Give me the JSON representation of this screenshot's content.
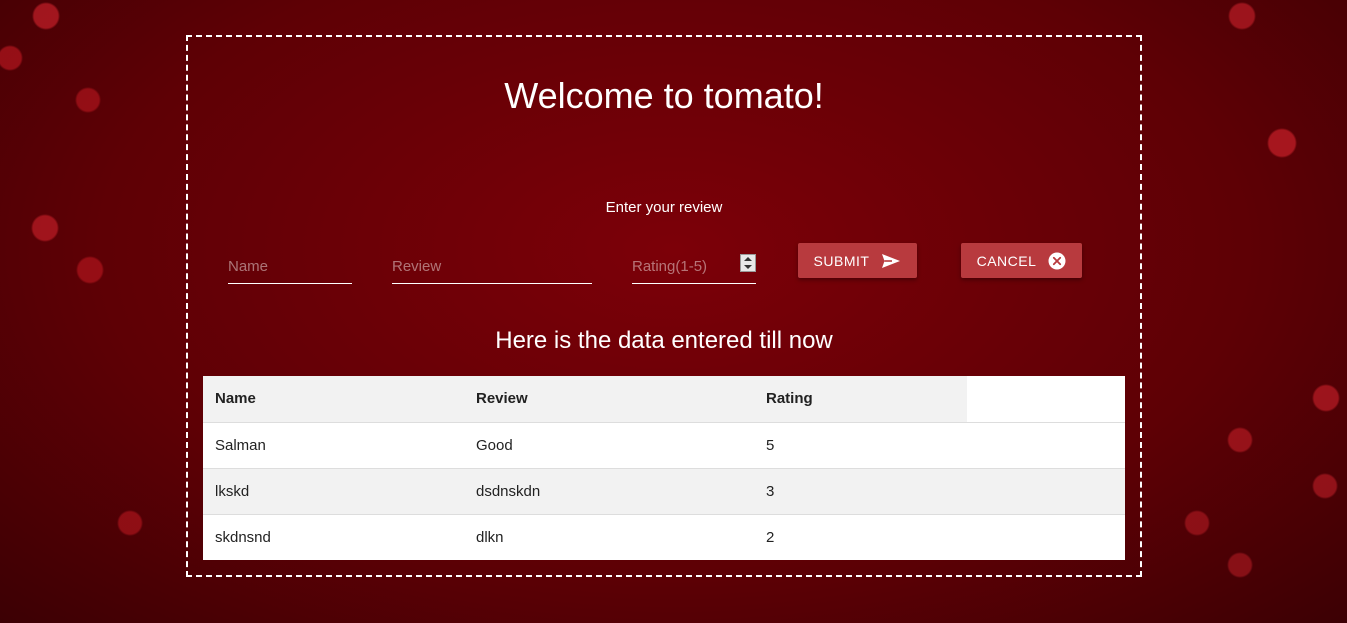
{
  "header": {
    "title": "Welcome to tomato!"
  },
  "form": {
    "label": "Enter your review",
    "name_placeholder": "Name",
    "review_placeholder": "Review",
    "rating_placeholder": "Rating(1-5)",
    "submit_label": "SUBMIT",
    "cancel_label": "CANCEL"
  },
  "results": {
    "heading": "Here is the data entered till now",
    "columns": [
      "Name",
      "Review",
      "Rating"
    ],
    "rows": [
      {
        "name": "Salman",
        "review": "Good",
        "rating": "5"
      },
      {
        "name": "lkskd",
        "review": "dsdnskdn",
        "rating": "3"
      },
      {
        "name": "skdnsnd",
        "review": "dlkn",
        "rating": "2"
      }
    ]
  },
  "colors": {
    "button": "#b83a3e",
    "background": "#6a0006"
  },
  "icons": {
    "submit": "send-icon",
    "cancel": "close-circle-icon"
  }
}
